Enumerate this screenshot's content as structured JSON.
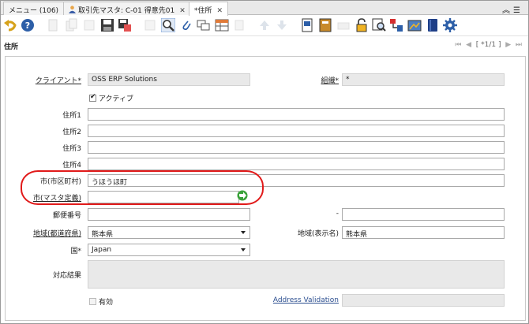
{
  "tabs": [
    {
      "label": "メニュー (106)",
      "closable": false
    },
    {
      "label": "取引先マスタ: C-01 得意先01",
      "closable": true
    },
    {
      "label": "*住所",
      "closable": true
    }
  ],
  "page": {
    "title": "住所",
    "record_nav": "[ *1/1 ]"
  },
  "form": {
    "client": {
      "label": "クライアント",
      "value": "OSS ERP Solutions"
    },
    "org": {
      "label": "組織",
      "value": "*"
    },
    "active": {
      "label": "アクティブ",
      "checked": true
    },
    "address1": {
      "label": "住所1",
      "value": ""
    },
    "address2": {
      "label": "住所2",
      "value": ""
    },
    "address3": {
      "label": "住所3",
      "value": ""
    },
    "address4": {
      "label": "住所4",
      "value": ""
    },
    "city": {
      "label": "市(市区町村)",
      "value": "うほうほ町"
    },
    "city_master": {
      "label": "市(マスタ定義)",
      "value": ""
    },
    "postal": {
      "label": "郵便番号",
      "value": ""
    },
    "postal_ext": {
      "label": "-",
      "value": ""
    },
    "region": {
      "label": "地域(都道府県)",
      "value": "熊本県"
    },
    "region_display": {
      "label": "地域(表示名)",
      "value": "熊本県"
    },
    "country": {
      "label": "国",
      "value": "Japan"
    },
    "result": {
      "label": "対応結果",
      "value": ""
    },
    "valid": {
      "label": "有効",
      "checked": false
    },
    "address_validation": {
      "label": "Address Validation",
      "value": ""
    }
  },
  "colors": {
    "highlight": "#e11a1a",
    "link": "#2a4d8f"
  }
}
